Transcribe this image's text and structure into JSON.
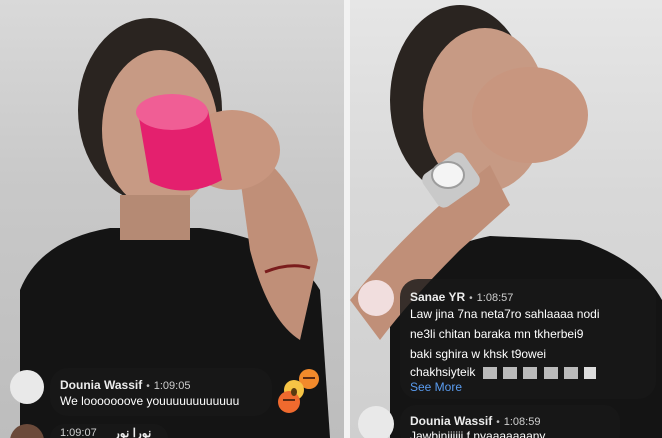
{
  "left_frame": {
    "comment": {
      "author": "Dounia Wassif",
      "separator": "•",
      "time": "1:09:05",
      "text": "We looooooove youuuuuuuuuuuu"
    },
    "next_comment": {
      "time": "1:09:07",
      "author_partial": "نورا نور"
    },
    "reactions": [
      "angry-emoji",
      "wow-emoji",
      "angry-emoji"
    ],
    "colors": {
      "cup": "#e4206e",
      "sweater": "#141414",
      "bubble": "#191919"
    }
  },
  "right_frame": {
    "comment": {
      "author": "Sanae YR",
      "separator": "•",
      "time": "1:08:57",
      "lines": [
        "Law jina 7na neta7ro sahlaaaa nodi",
        "ne3li chitan baraka mn tkherbei9",
        "baki sghira w khsk t9owei"
      ],
      "last_line": "chakhsiyteik",
      "see_more": "See More"
    },
    "next_comment": {
      "author": "Dounia Wassif",
      "separator": "•",
      "time": "1:08:59",
      "text_partial": "Jawbinjiiiii f nyaaaaaaany"
    },
    "colors": {
      "watch": "#c9c9c9",
      "link": "#5a9cf0"
    }
  }
}
